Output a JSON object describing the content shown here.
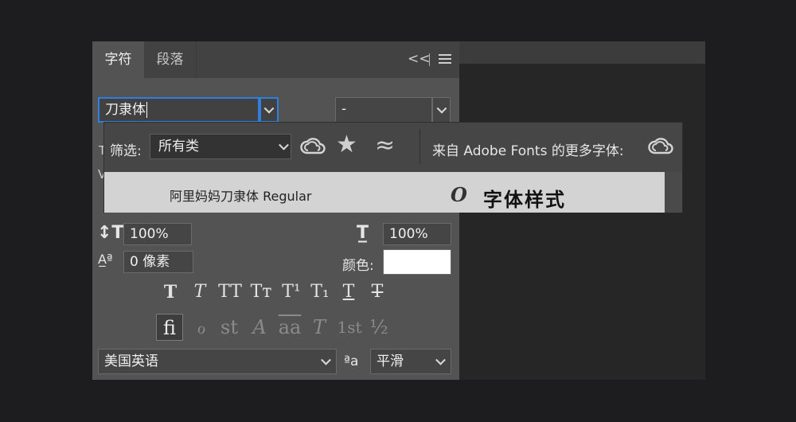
{
  "tabs": {
    "character": "字符",
    "paragraph": "段落"
  },
  "panel_controls": {
    "collapse": "<<"
  },
  "font": {
    "family_value": "刀隶体",
    "style_value": "-"
  },
  "popup": {
    "filter_label": "筛选:",
    "filter_value": "所有类",
    "more_fonts_label": "来自 Adobe Fonts 的更多字体:",
    "result": {
      "name": "阿里妈妈刀隶体 Regular",
      "type_icon": "O",
      "sample": "字体样式"
    }
  },
  "peek_labels": {
    "a": "T",
    "b": "V"
  },
  "scaling": {
    "vertical": "100%",
    "horizontal": "100%"
  },
  "baseline": {
    "value": "0 像素"
  },
  "color": {
    "label": "颜色:",
    "swatch": "#ffffff"
  },
  "type_styles": [
    "T",
    "T",
    "TT",
    "Tт",
    "T¹",
    "T₁",
    "T",
    "T"
  ],
  "opentype": [
    "fi",
    "ℴ",
    "st",
    "A",
    "aa",
    "T",
    "1st",
    "½"
  ],
  "language": {
    "value": "美国英语"
  },
  "antialias": {
    "icon": "ªa",
    "value": "平滑"
  },
  "icons": [
    "collapse-icon",
    "menu-icon",
    "creative-cloud-icon",
    "star-icon",
    "approx-icon",
    "vertical-scale-icon",
    "horizontal-scale-icon",
    "baseline-shift-icon",
    "antialias-icon"
  ]
}
